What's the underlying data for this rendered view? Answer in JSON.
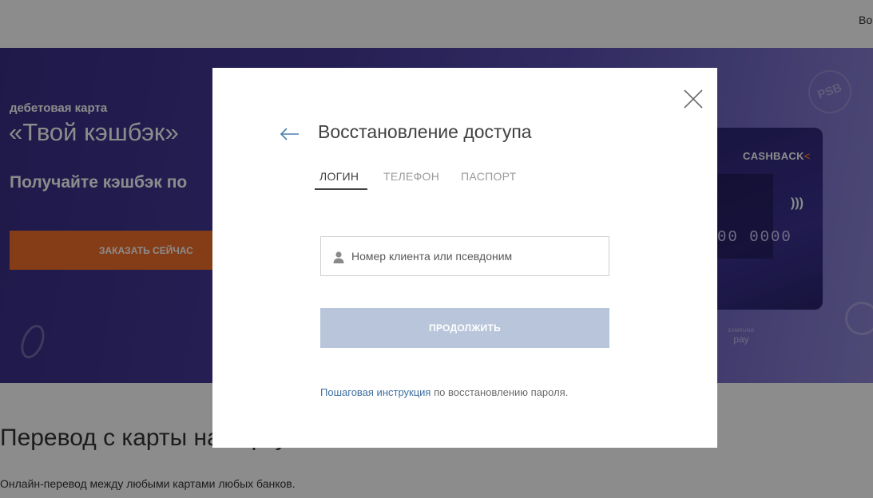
{
  "page": {
    "topbar_link": "Во",
    "banner": {
      "subtitle": "дебетовая карта",
      "title": "«Твой кэшбэк»",
      "tagline": "Получайте кэшбэк по",
      "cta_label": "ЗАКАЗАТЬ СЕЙЧАС"
    },
    "card": {
      "brand": "CASHBACK",
      "brand_mark": "<",
      "number_fragment": "00 0000",
      "logo": "PSB",
      "samsung_line1": "SAMSUNG",
      "samsung_line2": "pay"
    },
    "section": {
      "title": "Перевод с карты на карту",
      "text": "Онлайн-перевод между любыми картами любых банков."
    }
  },
  "modal": {
    "title": "Восстановление доступа",
    "tabs": [
      {
        "label": "ЛОГИН",
        "active": true
      },
      {
        "label": "ТЕЛЕФОН",
        "active": false
      },
      {
        "label": "ПАСПОРТ",
        "active": false
      }
    ],
    "input": {
      "placeholder": "Номер клиента или псевдоним",
      "value": ""
    },
    "submit_label": "ПРОДОЛЖИТЬ",
    "help": {
      "link_text": "Пошаговая инструкция",
      "rest_text": " по восстановлению пароля."
    }
  },
  "colors": {
    "accent_orange": "#f2702a",
    "banner_purple": "#45399a",
    "link_blue": "#3f6f9e",
    "button_disabled": "#b9c5da"
  }
}
